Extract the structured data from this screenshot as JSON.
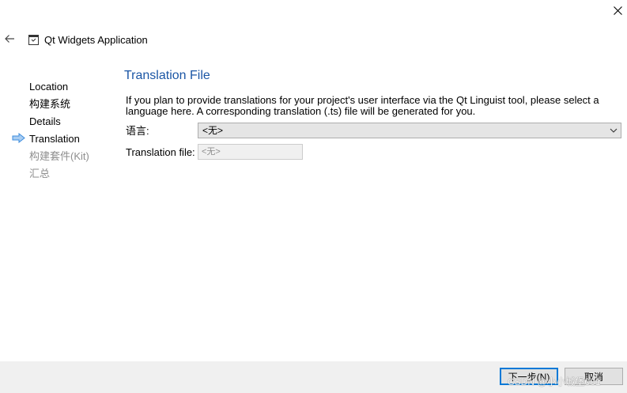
{
  "window": {
    "title": "Qt Widgets Application"
  },
  "sidebar": {
    "items": [
      {
        "label": "Location",
        "state": "done"
      },
      {
        "label": "构建系统",
        "state": "done"
      },
      {
        "label": "Details",
        "state": "done"
      },
      {
        "label": "Translation",
        "state": "current"
      },
      {
        "label": "构建套件(Kit)",
        "state": "pending"
      },
      {
        "label": "汇总",
        "state": "pending"
      }
    ]
  },
  "page": {
    "title": "Translation File",
    "description": "If you plan to provide translations for your project's user interface via the Qt Linguist tool, please select a language here. A corresponding translation (.ts) file will be generated for you.",
    "language_label": "语言:",
    "language_value": "<无>",
    "translation_file_label": "Translation file:",
    "translation_file_value": "<无>"
  },
  "footer": {
    "next_label": "下一步(N)",
    "cancel_label": "取消"
  },
  "watermark": "CSDN @小小城堡001",
  "colors": {
    "title_blue": "#1b56a5",
    "current_arrow": "#3c8dde",
    "focus_border": "#0078d7"
  },
  "icons": {
    "close": "close-icon",
    "back": "back-arrow-icon",
    "wizard": "wizard-window-icon",
    "current_step": "current-step-arrow-icon",
    "dropdown": "chevron-down-icon"
  }
}
